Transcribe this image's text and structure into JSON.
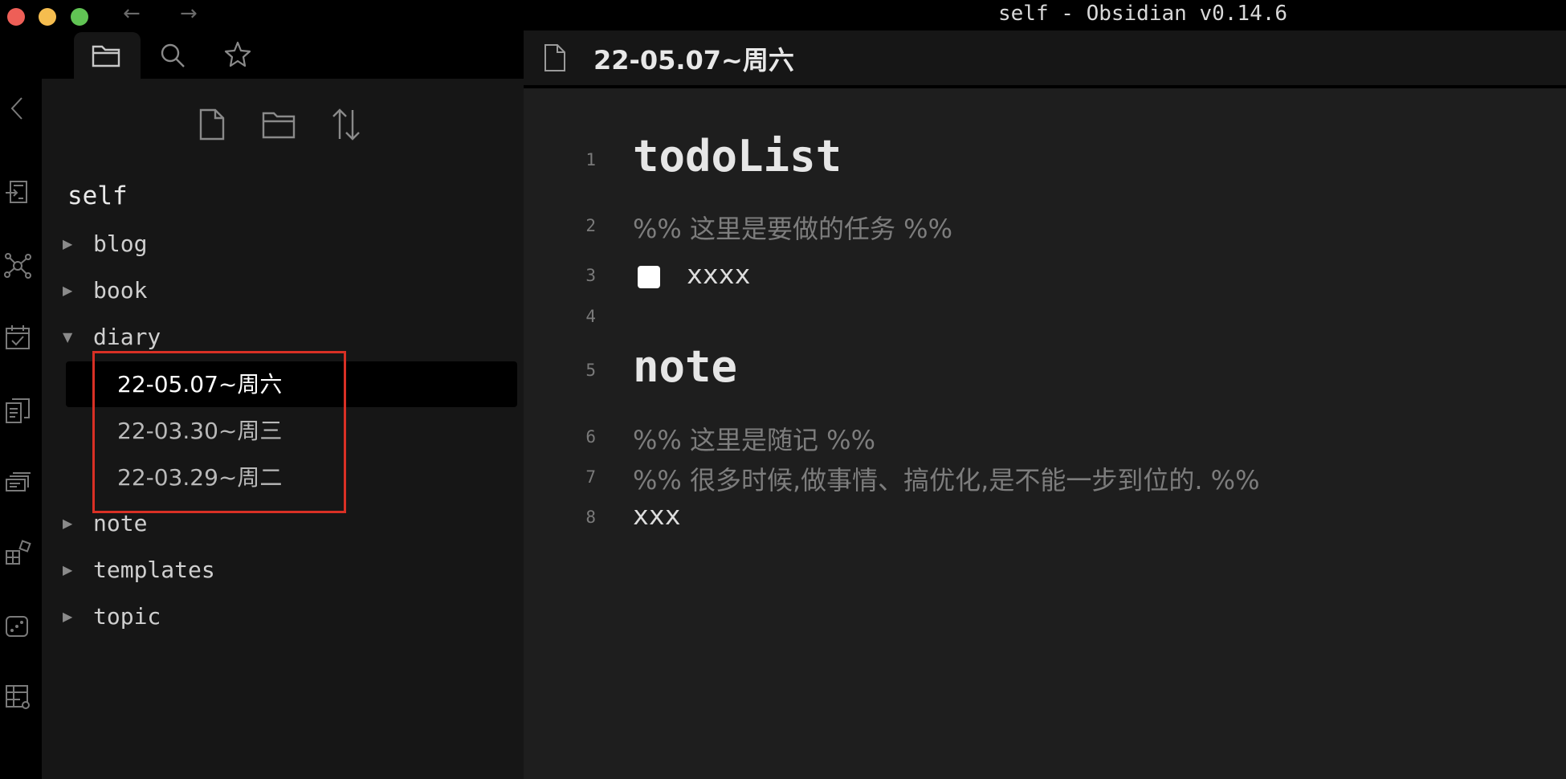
{
  "window": {
    "title": "self - Obsidian v0.14.6",
    "back_arrow": "←",
    "forward_arrow": "→"
  },
  "sidebar": {
    "tabs": [
      {
        "name": "file-explorer",
        "icon": "folder-icon",
        "active": true
      },
      {
        "name": "search",
        "icon": "search-icon",
        "active": false
      },
      {
        "name": "starred",
        "icon": "star-icon",
        "active": false
      }
    ],
    "actions": [
      {
        "name": "new-note",
        "icon": "new-file-icon"
      },
      {
        "name": "new-folder",
        "icon": "new-folder-icon"
      },
      {
        "name": "sort",
        "icon": "sort-icon"
      }
    ],
    "vault_name": "self",
    "folders": [
      {
        "label": "blog",
        "expanded": false
      },
      {
        "label": "book",
        "expanded": false
      },
      {
        "label": "diary",
        "expanded": true
      },
      {
        "label": "note",
        "expanded": false
      },
      {
        "label": "templates",
        "expanded": false
      },
      {
        "label": "topic",
        "expanded": false
      }
    ],
    "diary_files": [
      {
        "label": "22-05.07~周六",
        "active": true
      },
      {
        "label": "22-03.30~周三",
        "active": false
      },
      {
        "label": "22-03.29~周二",
        "active": false
      }
    ],
    "caret_collapsed": "▶",
    "caret_expanded": "▼"
  },
  "ribbon": {
    "icons": [
      "collapse-chevron-icon",
      "switcher-icon",
      "graph-icon",
      "daily-note-icon",
      "templates-icon",
      "slides-icon",
      "plugins-icon",
      "random-note-icon",
      "table-settings-icon"
    ]
  },
  "editor": {
    "title": "22-05.07~周六",
    "lines": [
      {
        "num": "1",
        "text": "todoList"
      },
      {
        "num": "2",
        "text": "%%  这里是要做的任务  %%"
      },
      {
        "num": "3",
        "text": "xxxx"
      },
      {
        "num": "4",
        "text": ""
      },
      {
        "num": "5",
        "text": "note"
      },
      {
        "num": "6",
        "text": "%%  这里是随记  %%"
      },
      {
        "num": "7",
        "text": "%%  很多时候,做事情、搞优化,是不能一步到位的.  %%"
      },
      {
        "num": "8",
        "text": "xxx"
      }
    ]
  },
  "colors": {
    "accent_highlight": "#d93025",
    "traffic_red": "#ee5f57",
    "traffic_yellow": "#f5bd4f",
    "traffic_green": "#61c454"
  }
}
